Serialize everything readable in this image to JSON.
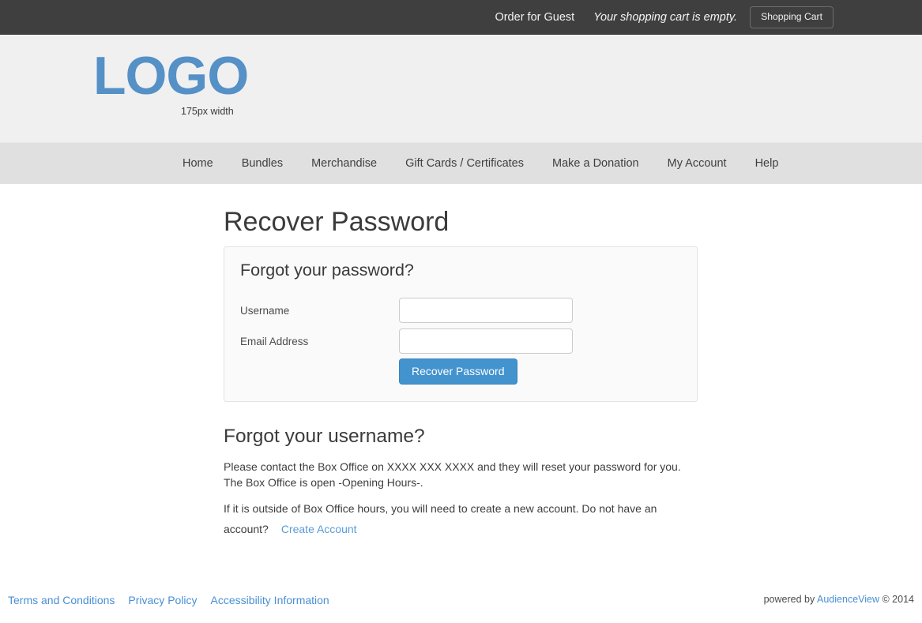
{
  "topbar": {
    "order_for": "Order for Guest",
    "cart_message": "Your shopping cart is empty.",
    "cart_button": "Shopping Cart"
  },
  "branding": {
    "logo_text": "LOGO",
    "logo_caption": "175px width",
    "logo_color": "#5590c7"
  },
  "nav": {
    "items": [
      {
        "label": "Home"
      },
      {
        "label": "Bundles"
      },
      {
        "label": "Merchandise"
      },
      {
        "label": "Gift Cards / Certificates"
      },
      {
        "label": "Make a Donation"
      },
      {
        "label": "My Account"
      },
      {
        "label": "Help"
      }
    ]
  },
  "main": {
    "page_title": "Recover Password",
    "panel": {
      "heading": "Forgot your password?",
      "fields": [
        {
          "label": "Username",
          "value": "",
          "placeholder": ""
        },
        {
          "label": "Email Address",
          "value": "",
          "placeholder": ""
        }
      ],
      "submit_label": "Recover Password",
      "submit_color": "#4393ce"
    },
    "username_section": {
      "heading": "Forgot your username?",
      "paragraph_1": "Please contact the Box Office on XXXX XXX XXXX and they will reset your password for you. The Box Office is open -Opening Hours-.",
      "paragraph_2": "If it is outside of Box Office hours, you will need to create a new account. Do not have an account?",
      "create_account_link": "Create Account"
    }
  },
  "footer": {
    "links": [
      {
        "label": "Terms and Conditions"
      },
      {
        "label": "Privacy Policy"
      },
      {
        "label": "Accessibility Information"
      }
    ],
    "powered_by_prefix": "powered by",
    "powered_by_brand": "AudienceView",
    "copyright": "© 2014",
    "link_color": "#4a8fd4"
  }
}
